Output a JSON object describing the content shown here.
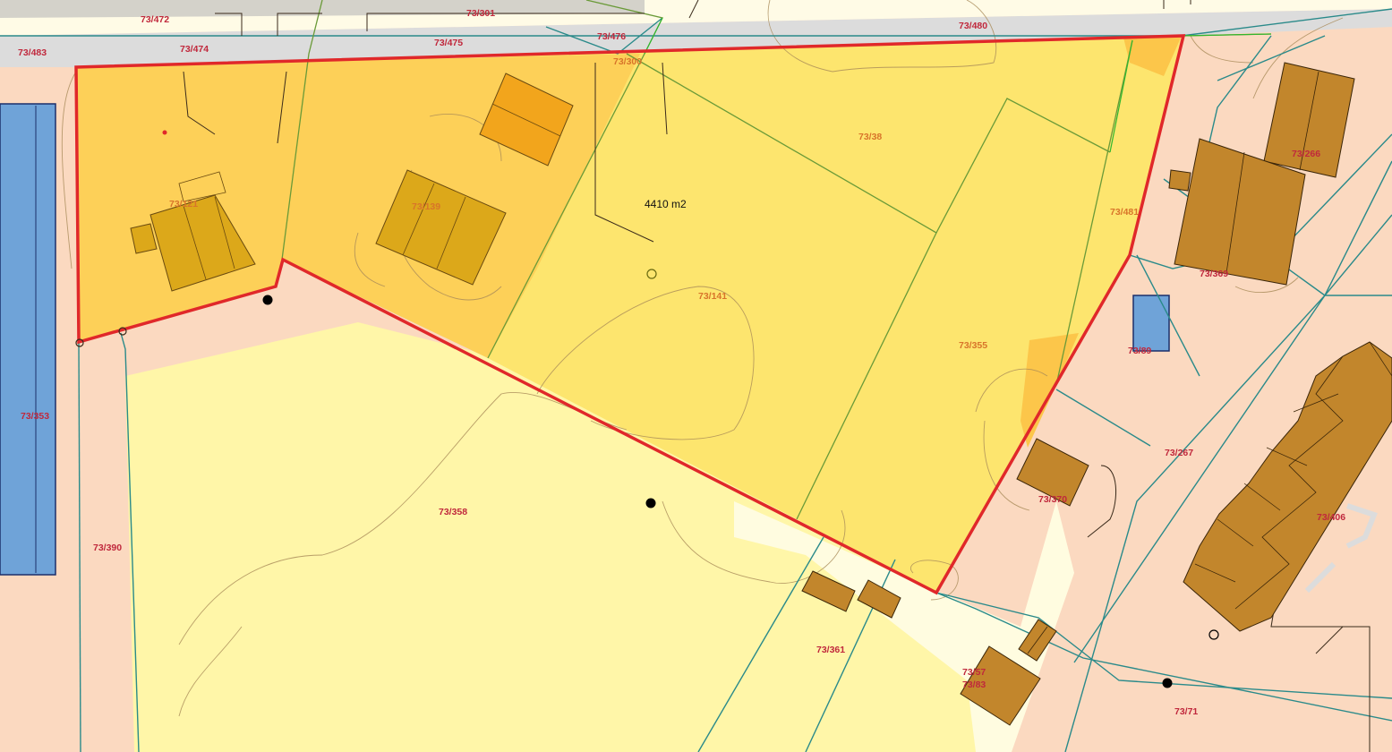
{
  "map": {
    "area_label": "4410 m2",
    "colors": {
      "background_zone": "#fbd9c0",
      "light_yellow_zone": "#fff6a8",
      "yellow_zone": "#fde56e",
      "dark_yellow_zone": "#fdd058",
      "road": "#dcdcdc",
      "building": "#c2862c",
      "building_highlight": "#dca81a",
      "building_orange": "#f2a51c",
      "water_blue": "#6fa3d8",
      "property_boundary": "#e0282a",
      "parcel_line": "#2a8a8a",
      "parcel_line_green": "#6a9a38",
      "contour": "#a88a58",
      "label_red": "#c0283c",
      "label_orange": "#d8742a"
    },
    "parcel_labels": [
      "73/472",
      "73/301",
      "73/483",
      "73/474",
      "73/475",
      "73/476",
      "73/480",
      "73/300",
      "73/38",
      "73/121",
      "73/139",
      "73/266",
      "73/481",
      "73/369",
      "73/141",
      "73/89",
      "73/355",
      "73/353",
      "73/267",
      "73/370",
      "73/358",
      "73/406",
      "73/390",
      "73/361",
      "73/57",
      "73/83",
      "73/71"
    ]
  }
}
